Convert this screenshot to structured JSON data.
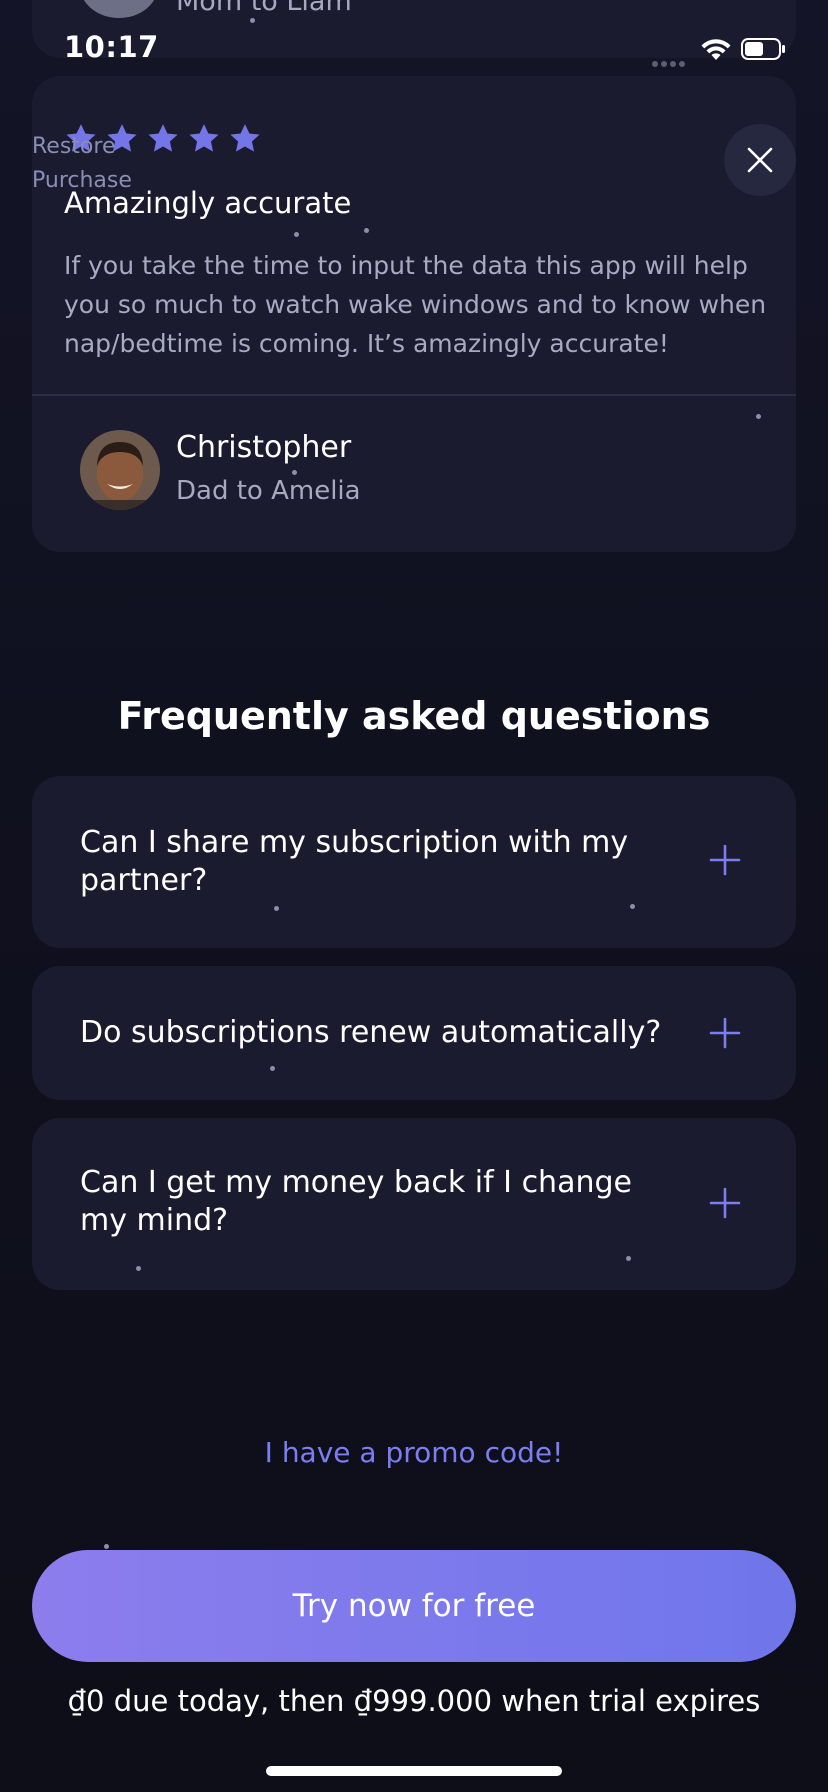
{
  "status_bar": {
    "time": "10:17"
  },
  "previous_review": {
    "author_role": "Mom to Liam"
  },
  "header": {
    "restore_purchase": "Restore\nPurchase"
  },
  "review": {
    "rating": 5,
    "title": "Amazingly accurate",
    "body": "If you take the time to input the data this app will help you so much to watch wake windows and to know when nap/bedtime is coming. It’s amazingly accurate!",
    "author_name": "Christopher",
    "author_role": "Dad to Amelia"
  },
  "faq": {
    "title": "Frequently asked questions",
    "items": [
      {
        "question": "Can I share my subscription with my partner?"
      },
      {
        "question": "Do subscriptions renew automatically?"
      },
      {
        "question": "Can I get my money back if I change my mind?"
      }
    ]
  },
  "promo_link": "I have a promo code!",
  "cta": {
    "label": "Try now for free",
    "price_note": "₫0 due today, then ₫999.000 when trial expires"
  },
  "colors": {
    "background": "#10111f",
    "card": "#1a1b2e",
    "accent": "#7c7ef0",
    "cta_gradient_start": "#8d7ded",
    "cta_gradient_end": "#6f76ea"
  }
}
